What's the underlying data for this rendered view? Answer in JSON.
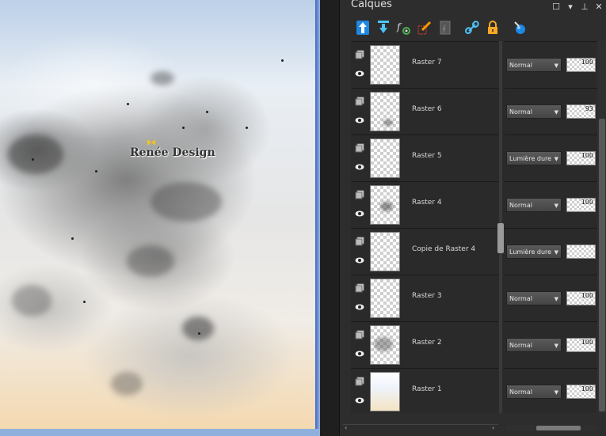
{
  "panel": {
    "title": "Calques",
    "controls": [
      "restore-icon",
      "dropdown-icon",
      "pin-icon",
      "close-icon"
    ]
  },
  "canvas": {
    "watermark": "Renée Design"
  },
  "toolbar": {
    "tools": [
      "move-layer-up-icon",
      "move-layer-down-icon",
      "layer-effects-icon",
      "edit-selection-icon",
      "mask-icon",
      "link-icon",
      "lock-icon",
      "layer-style-icon"
    ]
  },
  "layers": [
    {
      "name": "Raster 7",
      "blend": "Normal",
      "opacity": "100",
      "thumb": "empty"
    },
    {
      "name": "Raster 6",
      "blend": "Normal",
      "opacity": "93",
      "thumb": "blot-bottom"
    },
    {
      "name": "Raster 5",
      "blend": "Lumière dure",
      "opacity": "100",
      "thumb": "empty"
    },
    {
      "name": "Raster 4",
      "blend": "Normal",
      "opacity": "100",
      "thumb": "blot-mid"
    },
    {
      "name": "Copie de Raster 4",
      "blend": "Lumière dure",
      "opacity": "",
      "thumb": "empty"
    },
    {
      "name": "Raster 3",
      "blend": "Normal",
      "opacity": "100",
      "thumb": "empty"
    },
    {
      "name": "Raster 2",
      "blend": "Normal",
      "opacity": "100",
      "thumb": "blot-cloud"
    },
    {
      "name": "Raster 1",
      "blend": "Normal",
      "opacity": "100",
      "thumb": "gradient"
    }
  ]
}
